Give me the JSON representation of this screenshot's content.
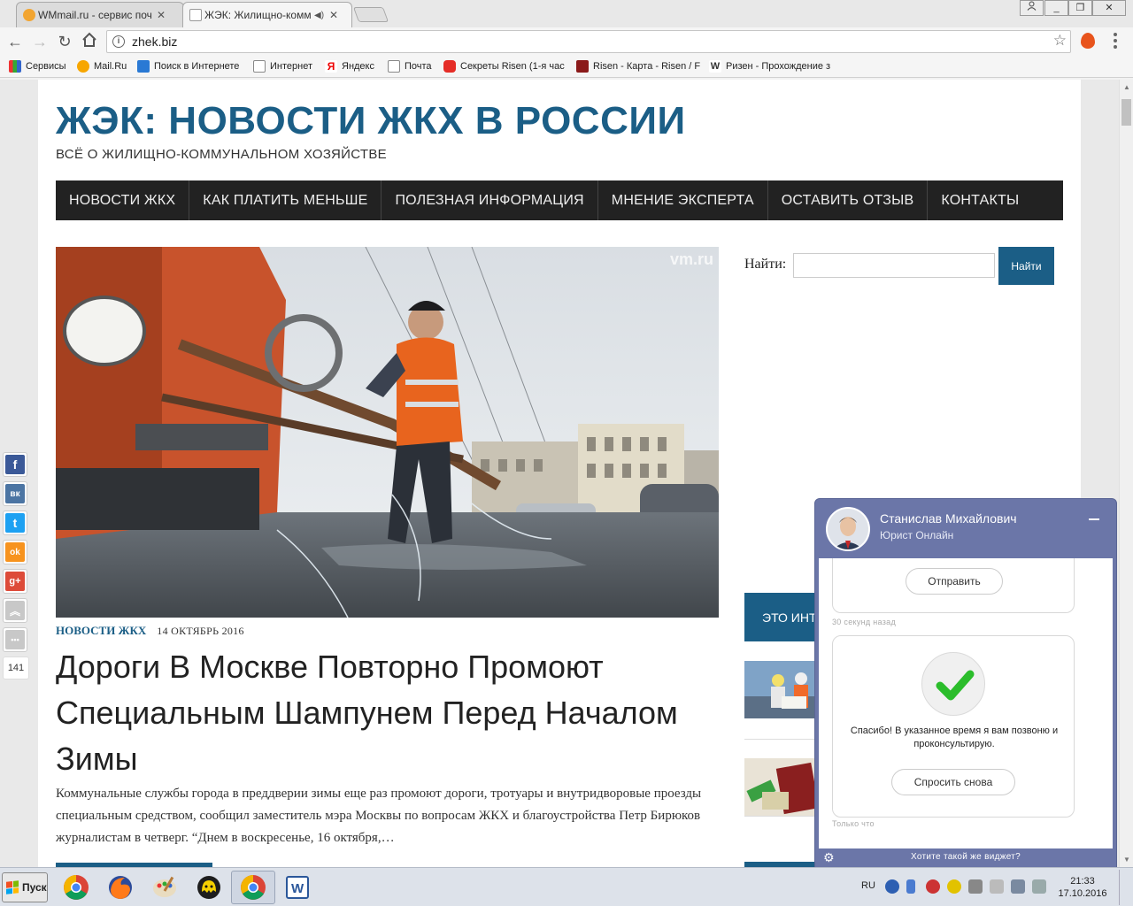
{
  "browser": {
    "tabs": [
      {
        "title": "WMmail.ru - сервис почтов",
        "active": false
      },
      {
        "title": "ЖЭК: Жилищно-комму",
        "active": true
      }
    ],
    "url": "zhek.biz",
    "bookmarks": [
      {
        "label": "Сервисы",
        "icon": "apps-grid-icon"
      },
      {
        "label": "Mail.Ru",
        "icon": "mailru-icon"
      },
      {
        "label": "Поиск в Интернете",
        "icon": "search-icon"
      },
      {
        "label": "Интернет",
        "icon": "page-icon"
      },
      {
        "label": "Яндекс",
        "icon": "yandex-icon"
      },
      {
        "label": "Почта",
        "icon": "page-icon"
      },
      {
        "label": "Секреты Risen (1-я час",
        "icon": "youtube-icon"
      },
      {
        "label": "Risen - Карта - Risen / F",
        "icon": "rpg-icon"
      },
      {
        "label": "Ризен - Прохождение з",
        "icon": "w-icon"
      }
    ]
  },
  "site": {
    "title": "ЖЭК: НОВОСТИ ЖКХ В РОССИИ",
    "tagline": "ВСЁ О ЖИЛИЩНО-КОММУНАЛЬНОМ ХОЗЯЙСТВЕ",
    "accent_color": "#1b5e86",
    "nav": [
      "НОВОСТИ ЖКХ",
      "КАК ПЛАТИТЬ МЕНЬШЕ",
      "ПОЛЕЗНАЯ ИНФОРМАЦИЯ",
      "МНЕНИЕ ЭКСПЕРТА",
      "ОСТАВИТЬ ОТЗЫВ",
      "КОНТАКТЫ"
    ]
  },
  "post": {
    "image_watermark": "vm.ru",
    "category": "НОВОСТИ ЖКХ",
    "date": "14 ОКТЯБРЬ 2016",
    "title": "Дороги В Москве Повторно Промоют Специальным Шампунем Перед Началом Зимы",
    "excerpt": "Коммунальные службы города в преддверии зимы еще раз промоют дороги, тротуары и внутридворовые проезды специальным средством, сообщил заместитель мэра Москвы по вопросам ЖКХ и благоустройства Петр Бирюков журналистам в четверг. “Днем в воскресенье, 16 октября,…"
  },
  "sidebar": {
    "search_label": "Найти:",
    "search_value": "",
    "search_button": "Найти",
    "banner_text": "ЭТО ИНТ"
  },
  "social": {
    "buttons": [
      {
        "name": "facebook",
        "glyph": "f",
        "color": "#3b5998"
      },
      {
        "name": "vkontakte",
        "glyph": "вк",
        "color": "#4c75a3"
      },
      {
        "name": "twitter",
        "glyph": "t",
        "color": "#1da1f2"
      },
      {
        "name": "odnoklassniki",
        "glyph": "ok",
        "color": "#f7931e"
      },
      {
        "name": "google-plus",
        "glyph": "g+",
        "color": "#dd4b39"
      },
      {
        "name": "scroll-top",
        "glyph": "︽",
        "color": "#c8c8c8"
      },
      {
        "name": "more",
        "glyph": "•••",
        "color": "#c8c8c8"
      }
    ],
    "count": "141"
  },
  "chat": {
    "agent_name": "Станислав Михайлович",
    "agent_role": "Юрист Онлайн",
    "send_button": "Отправить",
    "ts_first": "30 секунд назад",
    "thanks_text": "Спасибо! В указанное время я вам позвоню и проконсультирую.",
    "ask_again_button": "Спросить снова",
    "ts_second": "Только что",
    "footer_link": "Хотите такой же виджет?",
    "color": "#6b76a8"
  },
  "taskbar": {
    "start_label": "Пуск",
    "lang": "RU",
    "time": "21:33",
    "date": "17.10.2016"
  }
}
